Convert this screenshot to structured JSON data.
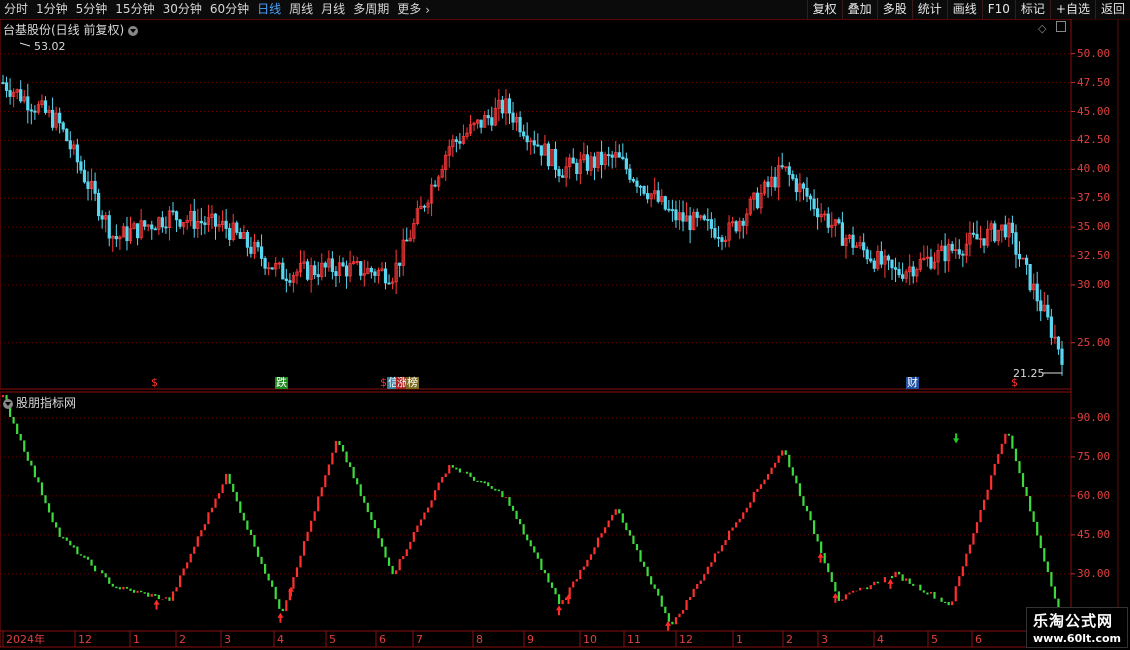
{
  "toolbar": {
    "items": [
      {
        "label": "分时",
        "active": false
      },
      {
        "label": "1分钟",
        "active": false
      },
      {
        "label": "5分钟",
        "active": false
      },
      {
        "label": "15分钟",
        "active": false
      },
      {
        "label": "30分钟",
        "active": false
      },
      {
        "label": "60分钟",
        "active": false
      },
      {
        "label": "日线",
        "active": true
      },
      {
        "label": "周线",
        "active": false
      },
      {
        "label": "月线",
        "active": false
      },
      {
        "label": "多周期",
        "active": false
      },
      {
        "label": "更多",
        "active": false
      }
    ],
    "right_buttons": [
      "复权",
      "叠加",
      "多股",
      "统计",
      "画线",
      "F10",
      "标记",
      "+自选",
      "返回"
    ]
  },
  "price_panel": {
    "title": "台基股份(日线 前复权)",
    "high_label": "53.02",
    "low_label": "21.25",
    "y_ticks": [
      "50.00",
      "47.50",
      "45.00",
      "42.50",
      "40.00",
      "37.50",
      "35.00",
      "32.50",
      "30.00",
      "25.00"
    ],
    "signals": [
      {
        "text": "$",
        "color": "#ff3030",
        "bg": ""
      },
      {
        "text": "跌",
        "color": "#ffffff",
        "bg": "#1f8a1f"
      },
      {
        "text": "$",
        "color": "#ff3030",
        "bg": ""
      },
      {
        "text": "信",
        "color": "#ffffff",
        "bg": "#2e7fa0"
      },
      {
        "text": "涨",
        "color": "#ffffff",
        "bg": "#b02020"
      },
      {
        "text": "榜",
        "color": "#ffffff",
        "bg": "#7a6a20"
      },
      {
        "text": "财",
        "color": "#ffffff",
        "bg": "#2050a0"
      },
      {
        "text": "$",
        "color": "#ff3030",
        "bg": ""
      }
    ]
  },
  "indicator_panel": {
    "title": "股朋指标网",
    "y_ticks": [
      "90.00",
      "75.00",
      "60.00",
      "45.00",
      "30.00"
    ]
  },
  "date_axis": {
    "labels": [
      "2024年",
      "12",
      "1",
      "2",
      "3",
      "4",
      "5",
      "6",
      "7",
      "8",
      "9",
      "10",
      "11",
      "12",
      "1",
      "2",
      "3",
      "4",
      "5",
      "6"
    ]
  },
  "watermark": {
    "title": "乐淘公式网",
    "url": "www.60lt.com"
  },
  "colors": {
    "up": "#ff3a3a",
    "down": "#5ad7f0",
    "indicator_up": "#ff3030",
    "indicator_down": "#3ddc3d",
    "grid": "#6a0000",
    "active_tab": "#4aa3ff"
  },
  "chart_data": [
    {
      "type": "line",
      "title": "台基股份(日线 前复权)",
      "x": [
        "2024-11",
        "2024-12",
        "2025-01",
        "2025-02",
        "2025-03",
        "2025-04",
        "2025-05",
        "2025-06",
        "2025-07",
        "2025-08",
        "2025-09",
        "2025-10",
        "2025-11",
        "2025-12",
        "2026-01",
        "2026-02",
        "2026-03",
        "2026-04",
        "2026-05",
        "2026-06"
      ],
      "series": [
        {
          "values": [
            47.5,
            44.0,
            34.0,
            36.0,
            35.0,
            31.0,
            31.5,
            31.0,
            42.0,
            45.5,
            40.0,
            41.0,
            36.0,
            34.5,
            40.0,
            34.5,
            31.0,
            33.0,
            35.0,
            24.0
          ]
        }
      ],
      "ylim": [
        21,
        53
      ],
      "annotations": [
        "53.02",
        "21.25"
      ]
    },
    {
      "type": "line",
      "title": "股朋指标网",
      "x": [
        "2024-11",
        "2024-12",
        "2025-01",
        "2025-02",
        "2025-03",
        "2025-04",
        "2025-05",
        "2025-06",
        "2025-07",
        "2025-08",
        "2025-09",
        "2025-10",
        "2025-11",
        "2025-12",
        "2026-01",
        "2026-02",
        "2026-03",
        "2026-04",
        "2026-05",
        "2026-06"
      ],
      "series": [
        {
          "values": [
            98,
            45,
            25,
            20,
            68,
            15,
            82,
            30,
            72,
            60,
            18,
            55,
            10,
            45,
            78,
            20,
            30,
            18,
            86,
            12
          ]
        }
      ],
      "ylim": [
        8,
        100
      ]
    }
  ]
}
